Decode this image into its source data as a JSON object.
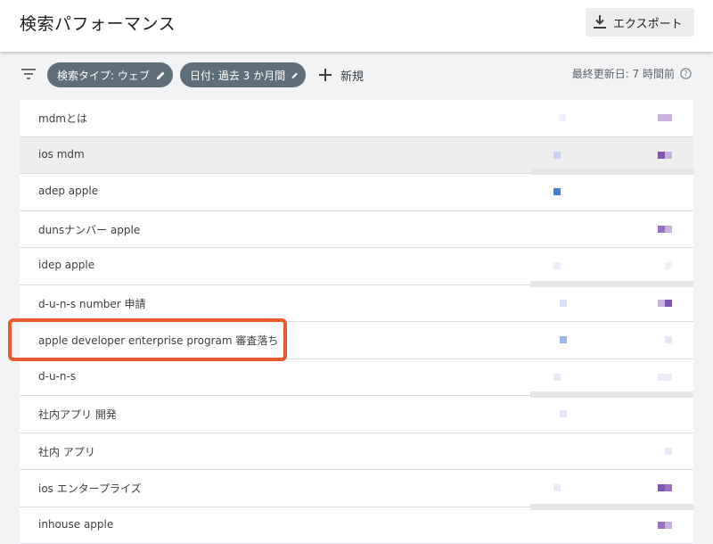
{
  "header": {
    "title": "検索パフォーマンス",
    "export_label": "エクスポート"
  },
  "filters": {
    "chips": [
      {
        "label": "検索タイプ: ウェブ"
      },
      {
        "label": "日付: 過去 3 か月間"
      }
    ],
    "new_label": "新規",
    "last_updated": "最終更新日: 7 時間前"
  },
  "queries": [
    {
      "label": "mdmとは",
      "highlight": false
    },
    {
      "label": "ios mdm",
      "highlight": true
    },
    {
      "label": "adep apple",
      "highlight": false
    },
    {
      "label": "dunsナンバー apple",
      "highlight": false
    },
    {
      "label": "idep apple",
      "highlight": false
    },
    {
      "label": "d-u-n-s number 申請",
      "highlight": false
    },
    {
      "label": "apple developer enterprise program 審査落ち",
      "highlight": false
    },
    {
      "label": "d-u-n-s",
      "highlight": false
    },
    {
      "label": "社内アプリ 開発",
      "highlight": false
    },
    {
      "label": "社内 アプリ",
      "highlight": false
    },
    {
      "label": "ios エンタープライズ",
      "highlight": false
    },
    {
      "label": "inhouse apple",
      "highlight": false
    }
  ],
  "colors": {
    "chip_bg": "#5f6f7a",
    "annotation_box": "#ea5a2a",
    "blue_metric": "#4a7fd0",
    "purple_metric": "#7e57b0"
  }
}
